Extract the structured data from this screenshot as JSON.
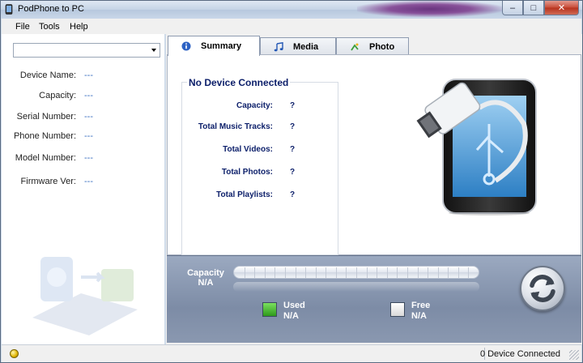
{
  "window": {
    "title": "PodPhone to PC"
  },
  "window_buttons": {
    "minimize": "–",
    "maximize": "□",
    "close": "✕"
  },
  "menu": [
    {
      "label": "File"
    },
    {
      "label": "Tools"
    },
    {
      "label": "Help"
    }
  ],
  "device_select": {
    "value": ""
  },
  "device_info": [
    {
      "label": "Device Name:",
      "value": "---"
    },
    {
      "label": "Capacity:",
      "value": "---"
    },
    {
      "label": "Serial Number:",
      "value": "---"
    },
    {
      "label": "Phone Number:",
      "value": "---"
    },
    {
      "label": "Model Number:",
      "value": "---"
    },
    {
      "label": "Firmware Ver:",
      "value": "---"
    }
  ],
  "tabs": [
    {
      "label": "Summary",
      "icon": "info-icon",
      "active": true
    },
    {
      "label": "Media",
      "icon": "music-note-icon",
      "active": false
    },
    {
      "label": "Photo",
      "icon": "photo-icon",
      "active": false
    }
  ],
  "summary": {
    "group_title": "No Device Connected",
    "stats": [
      {
        "label": "Capacity:",
        "value": "?"
      },
      {
        "label": "Total Music Tracks:",
        "value": "?"
      },
      {
        "label": "Total Videos:",
        "value": "?"
      },
      {
        "label": "Total Photos:",
        "value": "?"
      },
      {
        "label": "Total Playlists:",
        "value": "?"
      }
    ]
  },
  "capacity": {
    "label": "Capacity",
    "value": "N/A",
    "used_label": "Used",
    "used_value": "N/A",
    "free_label": "Free",
    "free_value": "N/A",
    "used_fraction": 0
  },
  "status": {
    "text": "0 Device Connected"
  },
  "colors": {
    "accent": "#0c1f6a",
    "value_blue": "#3a6fc0",
    "used": "#3fae2a",
    "free": "#e8e8e8",
    "status_led": "#e0b400"
  }
}
